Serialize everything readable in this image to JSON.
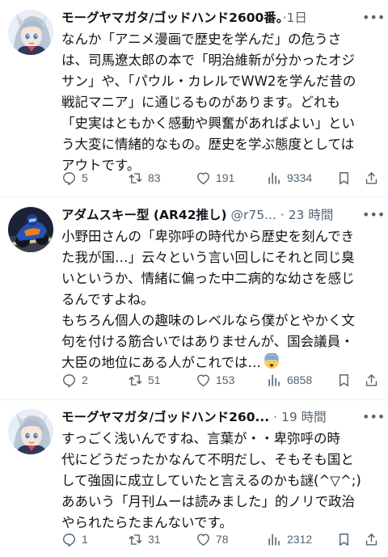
{
  "tweets": [
    {
      "author": "モーグヤマガタ/ゴッドハンド2600番。",
      "handle": "",
      "time": "1日",
      "lines": [
        "なんか「アニメ漫画で歴史を学んだ」の危うさ",
        "は、司馬遼太郎の本で「明治維新が分かったオジ",
        "サン」や、「パウル・カレルでWW2を学んだ昔の",
        "戦記マニア」に通じるものがあります。どれも",
        "「史実はともかく感動や興奮があればよい」とい",
        "う大変に情緒的なもの。歴史を学ぶ態度としては",
        "アウトです。"
      ],
      "replies": "5",
      "retweets": "83",
      "likes": "191",
      "views": "9334"
    },
    {
      "author": "アダムスキー型 (AR42推し)",
      "handle": "@r75...",
      "time": "23 時間",
      "lines": [
        "小野田さんの「卑弥呼の時代から歴史を刻んでき",
        "た我が国…」云々という言い回しにそれと同じ臭",
        "いというか、情緒に偏った中二病的な幼さを感じ",
        "るんですよね。",
        "もちろん個人の趣味のレベルなら僕がとやかく文",
        "句を付ける筋合いではありませんが、国会議員・",
        "大臣の地位にある人がこれでは…"
      ],
      "emoji": "fearful-face",
      "replies": "2",
      "retweets": "51",
      "likes": "153",
      "views": "6858"
    },
    {
      "author": "モーグヤマガタ/ゴッドハンド260...",
      "handle": "",
      "time": "19 時間",
      "lines": [
        "すっごく浅いんですね、言葉が・・卑弥呼の時",
        "代にどうだったかなんて不明だし、そもそも国と",
        "して強固に成立していたと言えるのかも謎(^▽^;)",
        "ああいう「月刊ムーは読みました」的ノリで政治",
        "やられたらたまんないです。"
      ],
      "replies": "1",
      "retweets": "31",
      "likes": "78",
      "views": "2312"
    }
  ],
  "colors": {
    "text": "#0f1419",
    "secondary": "#536471",
    "separator": "#eff3f4"
  }
}
